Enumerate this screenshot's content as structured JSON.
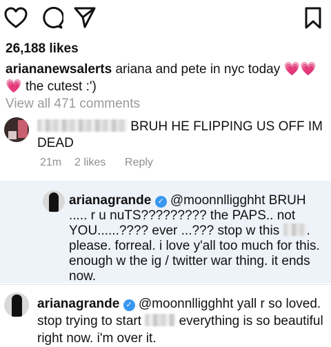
{
  "actions": {
    "like_icon": "heart-outline-icon",
    "comment_icon": "comment-bubble-icon",
    "share_icon": "send-plane-icon",
    "save_icon": "bookmark-icon"
  },
  "post": {
    "likes": "26,188 likes",
    "author": "ariananewsalerts",
    "caption_text": "ariana and pete in nyc today",
    "caption_text2": "the cutest :')",
    "view_all": "View all 471 comments"
  },
  "comment1": {
    "text": "BRUH HE FLIPPING US OFF IM DEAD",
    "time": "21m",
    "likes": "2 likes",
    "reply": "Reply"
  },
  "reply1": {
    "username": "arianagrande",
    "mention": "@moonnlligghht",
    "text1": "BRUH ..... r u nuTS????????? the PAPS.. not YOU......???? ever ...??? stop w this",
    "text2": ". please. forreal. i love y'all too much for this. enough w the ig / twitter war thing. it ends now."
  },
  "reply2": {
    "username": "arianagrande",
    "mention": "@moonnlligghht",
    "text1": "yall r so loved. stop trying to start",
    "text2": "everything is so beautiful right now. i'm over it."
  },
  "colors": {
    "verified": "#3897f0",
    "heart": "#e64992",
    "highlight_bg": "#eef2f9"
  }
}
